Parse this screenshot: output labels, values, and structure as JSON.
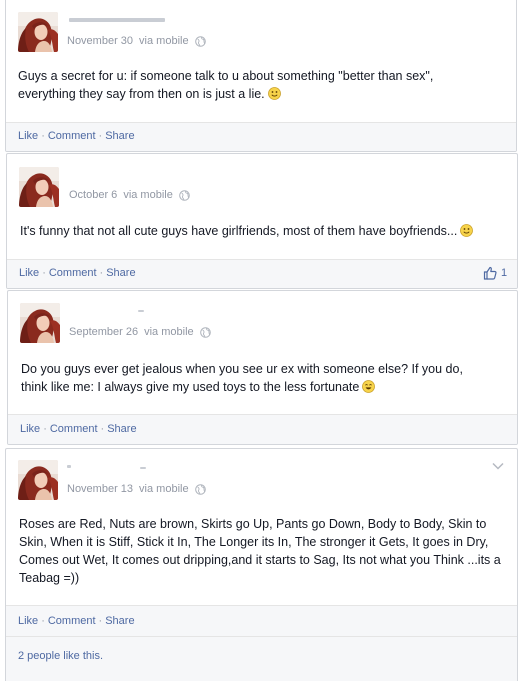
{
  "posts": [
    {
      "date": "November 30",
      "via": "via mobile",
      "text": "Guys a secret for u: if someone talk to u about something \"better than sex\", everything they say from then on is just a lie.",
      "emoji": "smile-emoji",
      "actions": {
        "like": "Like",
        "comment": "Comment",
        "share": "Share"
      }
    },
    {
      "date": "October 6",
      "via": "via mobile",
      "text": "It's funny that not all cute guys have girlfriends, most of them have boyfriends...",
      "emoji": "smile-emoji",
      "actions": {
        "like": "Like",
        "comment": "Comment",
        "share": "Share"
      },
      "like_count": "1"
    },
    {
      "date": "September 26",
      "via": "via mobile",
      "text": "Do you guys ever get jealous when you see ur ex with someone else? If you do, think like me: I always give my used toys to the less fortunate",
      "emoji": "happy-emoji",
      "actions": {
        "like": "Like",
        "comment": "Comment",
        "share": "Share"
      }
    },
    {
      "date": "November 13",
      "via": "via mobile",
      "text": "Roses are Red, Nuts are brown, Skirts go Up, Pants go Down, Body to Body, Skin to Skin, When it is Stiff, Stick it In, The Longer its In, The stronger it Gets, It goes in Dry, Comes out Wet, It comes out dripping,and it starts to Sag, Its not what you Think ...its a Teabag =))",
      "actions": {
        "like": "Like",
        "comment": "Comment",
        "share": "Share"
      },
      "likes_summary": "2 people like this."
    }
  ],
  "colors": {
    "link": "#4e69a2",
    "meta": "#9197a3",
    "border": "#d3d6db"
  }
}
